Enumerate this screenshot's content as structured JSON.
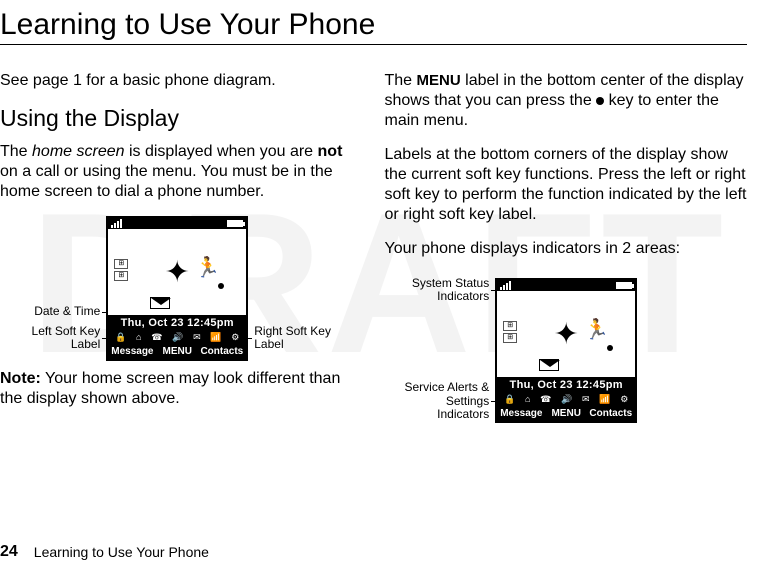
{
  "watermark": "DRAFT",
  "title": "Learning to Use Your Phone",
  "left_column": {
    "intro": "See page 1 for a basic phone diagram.",
    "section_heading": "Using the Display",
    "para1_pre": "The ",
    "para1_italic": "home screen",
    "para1_mid": " is displayed when you are ",
    "para1_bold": "not",
    "para1_post": " on a call or using the menu. You must be in the home screen to dial a phone number.",
    "note_label": "Note:",
    "note_text": " Your home screen may look different than the display shown above."
  },
  "right_column": {
    "para1_pre": "The ",
    "para1_menu": "MENU",
    "para1_post": " label in the bottom center of the display shows that you can press the ",
    "para1_key": "●",
    "para1_end": " key to enter the main menu.",
    "para2": "Labels at the bottom corners of the display show the current soft key functions. Press the left or right soft key to perform the function indicated by the left or right soft key label.",
    "para3": "Your phone displays indicators in 2 areas:"
  },
  "phone": {
    "datetime": "Thu, Oct 23 12:45pm",
    "softkeys": {
      "left": "Message",
      "center": "MENU",
      "right": "Contacts"
    }
  },
  "callouts_fig1": {
    "datetime": "Date & Time",
    "left_soft": "Left Soft Key\nLabel",
    "right_soft": "Right Soft Key\nLabel"
  },
  "callouts_fig2": {
    "status": "System Status\nIndicators",
    "alerts": "Service Alerts &\nSettings\nIndicators"
  },
  "footer": {
    "page_number": "24",
    "running_head": "Learning to Use Your Phone"
  }
}
